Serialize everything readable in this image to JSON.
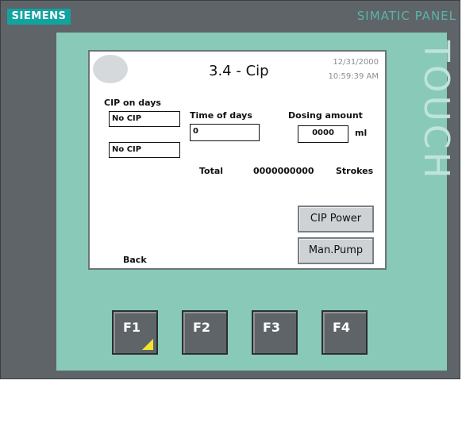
{
  "hardware": {
    "brand": "SIEMENS",
    "panel_label": "SIMATIC PANEL",
    "touch_label": "TOUCH",
    "fkeys": [
      "F1",
      "F2",
      "F3",
      "F4"
    ]
  },
  "screen": {
    "title": "3.4 - Cip",
    "date": "12/31/2000",
    "time": "10:59:39 AM",
    "cip_on_days_label": "CIP on days",
    "cip_field_1": "No CIP",
    "cip_field_2": "No CIP",
    "time_of_days_label": "Time of days",
    "time_of_days_value": "0",
    "dosing_amount_label": "Dosing amount",
    "dosing_amount_value": "0000",
    "dosing_unit": "ml",
    "total_label": "Total",
    "total_value": "0000000000",
    "strokes_label": "Strokes",
    "cip_power_button": "CIP Power",
    "man_pump_button": "Man.Pump",
    "back_label": "Back"
  },
  "colors": {
    "bezel": "#89c9b8",
    "frame": "#5f6468",
    "brand": "#11a3a0",
    "f1_indicator": "#f1e72a"
  }
}
